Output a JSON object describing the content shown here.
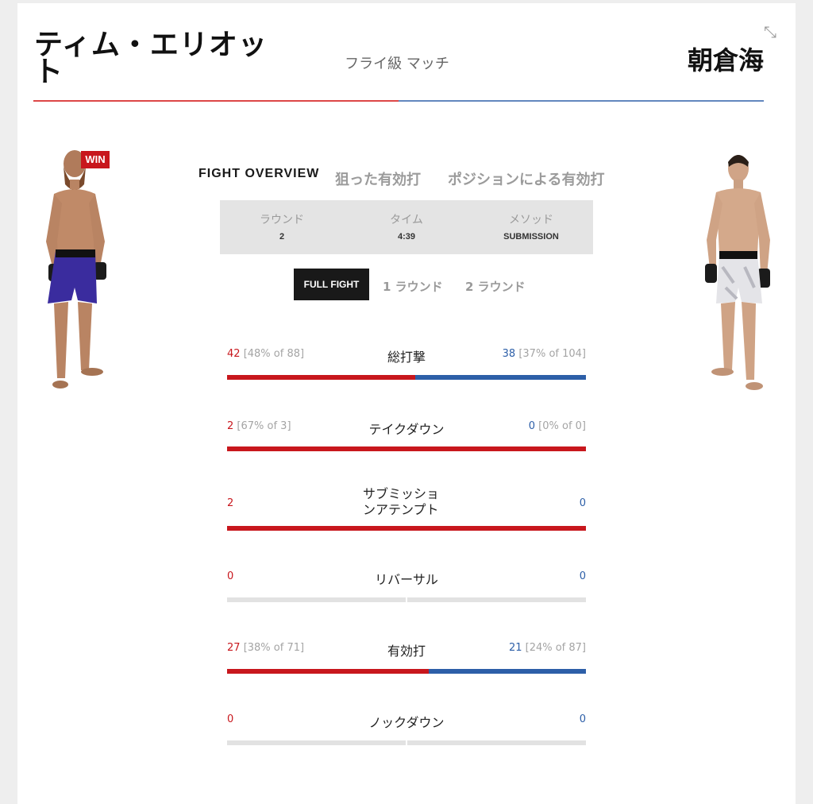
{
  "header": {
    "red_fighter": "ティム・エリオット",
    "blue_fighter": "朝倉海",
    "weight_class": "フライ級 マッチ",
    "win_badge": "WIN"
  },
  "colors": {
    "red": "#c8171d",
    "blue": "#2d5fa8"
  },
  "tabs": [
    "FIGHT OVERVIEW",
    "狙った有効打",
    "ポジションによる有効打"
  ],
  "summary": [
    {
      "label": "ラウンド",
      "value": "2"
    },
    {
      "label": "タイム",
      "value": "4:39"
    },
    {
      "label": "メソッド",
      "value": "SUBMISSION"
    }
  ],
  "round_buttons": [
    "FULL FIGHT",
    "1 ラウンド",
    "2 ラウンド"
  ],
  "stats": [
    {
      "name": "総打撃",
      "red": "42",
      "red_pct": "[48% of 88]",
      "blue": "38",
      "blue_pct": "[37% of 104]",
      "red_share": 0.525
    },
    {
      "name": "テイクダウン",
      "red": "2",
      "red_pct": "[67% of 3]",
      "blue": "0",
      "blue_pct": "[0% of 0]",
      "red_share": 1.0
    },
    {
      "name": "サブミッションアテンプト",
      "red": "2",
      "red_pct": "",
      "blue": "0",
      "blue_pct": "",
      "red_share": 1.0
    },
    {
      "name": "リバーサル",
      "red": "0",
      "red_pct": "",
      "blue": "0",
      "blue_pct": "",
      "red_share": null
    },
    {
      "name": "有効打",
      "red": "27",
      "red_pct": "[38% of 71]",
      "blue": "21",
      "blue_pct": "[24% of 87]",
      "red_share": 0.5625
    },
    {
      "name": "ノックダウン",
      "red": "0",
      "red_pct": "",
      "blue": "0",
      "blue_pct": "",
      "red_share": null
    }
  ]
}
